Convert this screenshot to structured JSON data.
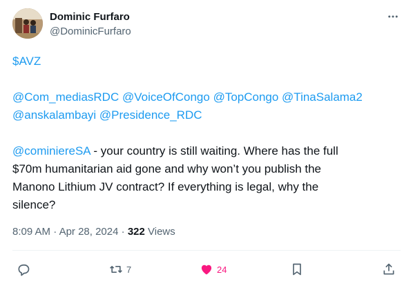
{
  "author": {
    "display_name": "Dominic Furfaro",
    "handle": "@DominicFurfaro"
  },
  "tweet": {
    "cashtag": "$AVZ",
    "mentions_line1": "@Com_mediasRDC @VoiceOfCongo @TopCongo @TinaSalama2",
    "mentions_line2": "@anskalambayi @Presidence_RDC",
    "reply_mention": "@cominiereSA",
    "body_line1": " - your country is still waiting. Where has the full",
    "body_line2": "$70m humanitarian aid gone and why won’t you publish the",
    "body_line3": "Manono Lithium JV contract? If everything is legal, why the",
    "body_line4": "silence?"
  },
  "meta": {
    "time": "8:09 AM",
    "separator": " · ",
    "date": "Apr 28, 2024",
    "views_count": "322",
    "views_label": " Views"
  },
  "actions": {
    "reply_count": "",
    "retweet_count": "7",
    "like_count": "24",
    "liked": true
  },
  "colors": {
    "accent": "#1d9bf0",
    "like": "#f91880",
    "secondary_text": "#536471",
    "primary_text": "#0f1419"
  }
}
